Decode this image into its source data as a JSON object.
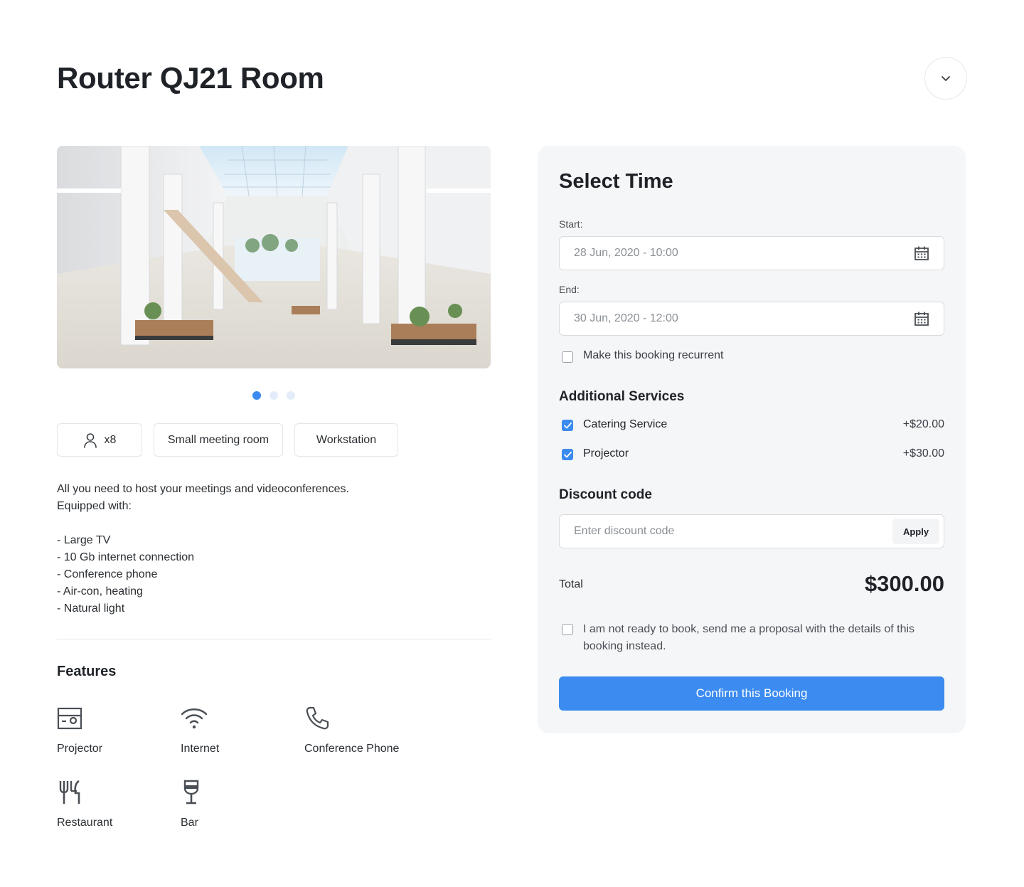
{
  "room": {
    "title": "Router QJ21 Room",
    "capacity": "x8",
    "tags": [
      "Small meeting room",
      "Workstation"
    ],
    "description_lines": [
      "All you need to host your meetings and videoconferences.",
      "Equipped with:",
      "",
      "- Large TV",
      "- 10 Gb internet connection",
      "- Conference phone",
      "- Air-con, heating",
      "- Natural light"
    ],
    "carousel": {
      "count": 3,
      "active": 1
    }
  },
  "features": {
    "title": "Features",
    "items": [
      {
        "label": "Projector",
        "icon": "projector-icon"
      },
      {
        "label": "Internet",
        "icon": "wifi-icon"
      },
      {
        "label": "Conference Phone",
        "icon": "phone-icon"
      },
      {
        "label": "Restaurant",
        "icon": "utensils-icon"
      },
      {
        "label": "Bar",
        "icon": "wine-glass-icon"
      }
    ]
  },
  "booking": {
    "title": "Select Time",
    "start_label": "Start:",
    "start_value": "28 Jun, 2020 - 10:00",
    "end_label": "End:",
    "end_value": "30 Jun, 2020 - 12:00",
    "recurrent_label": "Make this booking recurrent",
    "recurrent_checked": false,
    "services_title": "Additional Services",
    "services": [
      {
        "name": "Catering Service",
        "price": "+$20.00",
        "checked": true
      },
      {
        "name": "Projector",
        "price": "+$30.00",
        "checked": true
      }
    ],
    "discount_title": "Discount code",
    "discount_placeholder": "Enter discount code",
    "apply_label": "Apply",
    "total_label": "Total",
    "total_value": "$300.00",
    "proposal_label": "I am not ready to book, send me a proposal with the details of this booking instead.",
    "proposal_checked": false,
    "confirm_label": "Confirm this Booking"
  },
  "colors": {
    "accent": "#3b8bf0",
    "card_bg": "#f5f6f8",
    "text": "#1f2328"
  }
}
